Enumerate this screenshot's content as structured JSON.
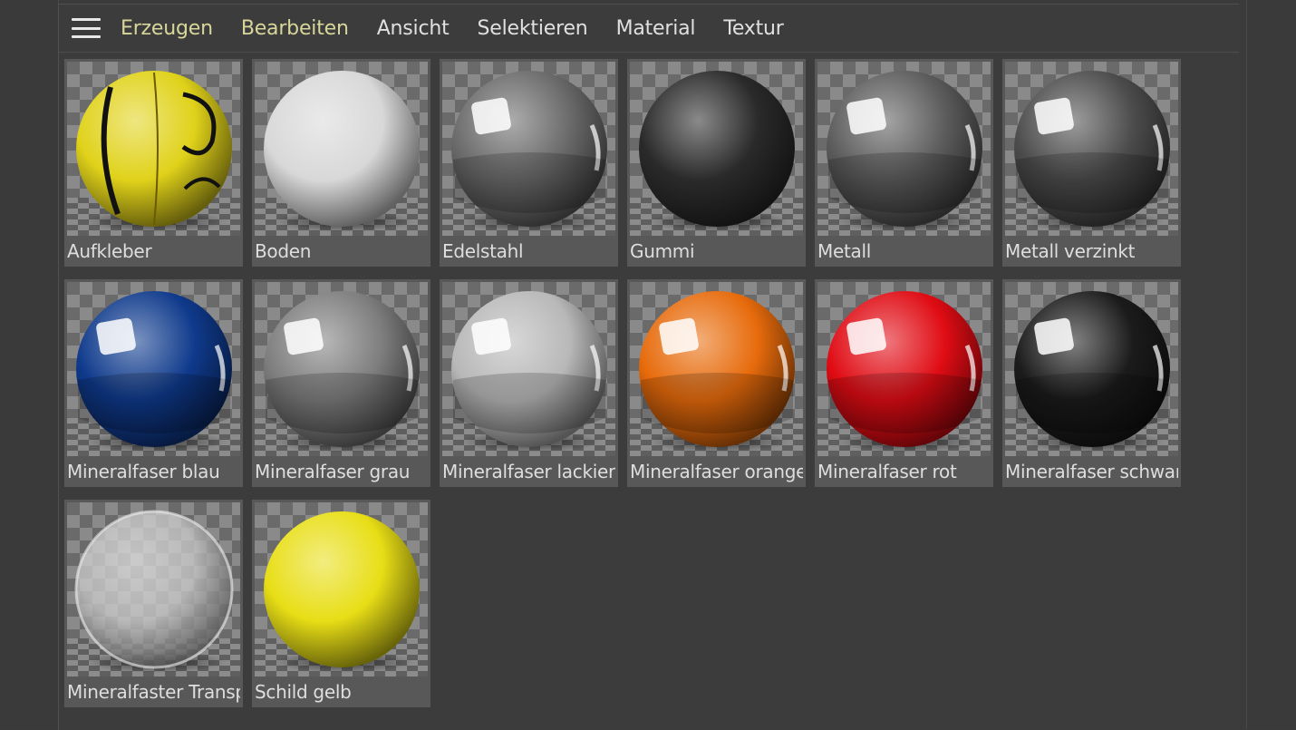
{
  "menu": {
    "items": [
      {
        "label": "Erzeugen",
        "active": true
      },
      {
        "label": "Bearbeiten",
        "active": true
      },
      {
        "label": "Ansicht",
        "active": false
      },
      {
        "label": "Selektieren",
        "active": false
      },
      {
        "label": "Material",
        "active": false
      },
      {
        "label": "Textur",
        "active": false
      }
    ]
  },
  "materials": [
    {
      "name": "Aufkleber",
      "base": "#e0d21a",
      "type": "sticker"
    },
    {
      "name": "Boden",
      "base": "#d8d8d8",
      "type": "matte"
    },
    {
      "name": "Edelstahl",
      "base": "#6a6a6a",
      "type": "metal"
    },
    {
      "name": "Gummi",
      "base": "#2a2a2a",
      "type": "matte"
    },
    {
      "name": "Metall",
      "base": "#5c5c5c",
      "type": "metal"
    },
    {
      "name": "Metall verzinkt",
      "base": "#4c4c4c",
      "type": "metal"
    },
    {
      "name": "Mineralfaser blau",
      "base": "#0f3a8c",
      "type": "gloss"
    },
    {
      "name": "Mineralfaser grau",
      "base": "#7d7d7d",
      "type": "gloss"
    },
    {
      "name": "Mineralfaser lackiert",
      "base": "#b8b8b8",
      "type": "gloss"
    },
    {
      "name": "Mineralfaser orange",
      "base": "#e76b0c",
      "type": "gloss"
    },
    {
      "name": "Mineralfaser rot",
      "base": "#e00c14",
      "type": "gloss"
    },
    {
      "name": "Mineralfaser schwarz",
      "base": "#1b1b1b",
      "type": "gloss"
    },
    {
      "name": "Mineralfaster Transparent",
      "base": "#c9c9c9",
      "type": "transparent"
    },
    {
      "name": "Schild gelb",
      "base": "#e8de16",
      "type": "matte"
    }
  ]
}
